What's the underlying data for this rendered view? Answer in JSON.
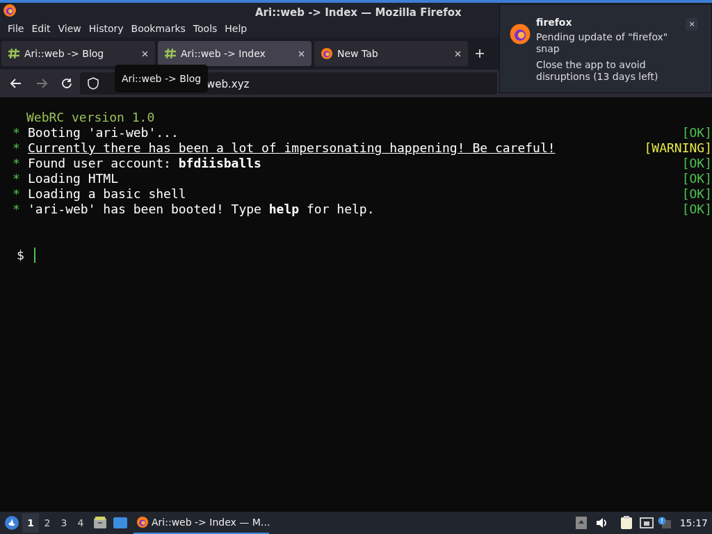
{
  "window": {
    "title": "Ari::web -> Index — Mozilla Firefox"
  },
  "menu": [
    "File",
    "Edit",
    "View",
    "History",
    "Bookmarks",
    "Tools",
    "Help"
  ],
  "tabs": [
    {
      "label": "Ari::web -> Blog",
      "selected": false,
      "kind": "site"
    },
    {
      "label": "Ari::web -> Index",
      "selected": true,
      "kind": "site"
    },
    {
      "label": "New Tab",
      "selected": false,
      "kind": "firefox"
    }
  ],
  "address": {
    "value": "web.xyz"
  },
  "tooltip": "Ari::web -> Blog",
  "terminal": {
    "header": "WebRC version 1.0",
    "lines": [
      {
        "bullet": "*",
        "text": "Booting 'ari-web'...",
        "status": "[OK]",
        "kind": "ok",
        "underlined": false
      },
      {
        "bullet": "*",
        "text": "Currently there has been a lot of impersonating happening! Be careful!",
        "status": "[WARNING]",
        "kind": "warning",
        "underlined": true
      },
      {
        "bullet": "*",
        "text": "Found user account: **bfdiisballs**",
        "status": "[OK]",
        "kind": "ok",
        "underlined": false
      },
      {
        "bullet": "*",
        "text": "Loading HTML",
        "status": "[OK]",
        "kind": "ok",
        "underlined": false
      },
      {
        "bullet": "*",
        "text": "Loading a basic shell",
        "status": "[OK]",
        "kind": "ok",
        "underlined": false
      },
      {
        "bullet": "*",
        "text": "'ari-web' has been booted! Type **help** for help.",
        "status": "[OK]",
        "kind": "ok",
        "underlined": false
      }
    ],
    "prompt": "$"
  },
  "notification": {
    "app": "firefox",
    "body": "Pending update of \"firefox\" snap",
    "detail": "Close the app to avoid disruptions (13 days left)",
    "close": "×"
  },
  "taskbar": {
    "workspaces": [
      {
        "label": "1",
        "selected": true
      },
      {
        "label": "2",
        "selected": false
      },
      {
        "label": "3",
        "selected": false
      },
      {
        "label": "4",
        "selected": false
      }
    ],
    "task": "Ari::web -> Index — M…",
    "clock": "15:17"
  }
}
